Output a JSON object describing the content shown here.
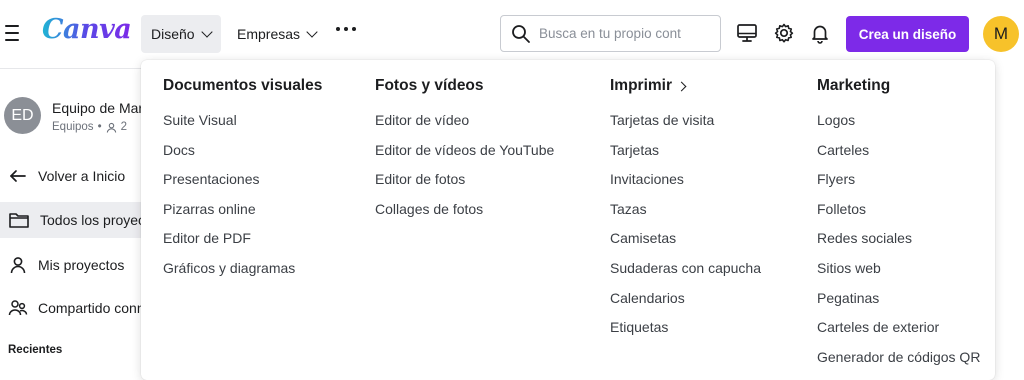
{
  "header": {
    "logo": "Canva",
    "nav": [
      {
        "label": "Diseño"
      },
      {
        "label": "Empresas"
      }
    ],
    "search_placeholder": "Busca en tu propio cont",
    "cta_label": "Crea un diseño",
    "avatar_initial": "M"
  },
  "sidebar": {
    "team_initials": "ED",
    "team_name": "Equipo de Mar",
    "team_type": "Equipos",
    "team_members": "2",
    "items": [
      {
        "label": "Volver a Inicio"
      },
      {
        "label": "Todos los proyec"
      },
      {
        "label": "Mis proyectos"
      },
      {
        "label": "Compartido conn"
      }
    ],
    "recent_label": "Recientes"
  },
  "megamenu": {
    "columns": [
      {
        "title": "Documentos visuales",
        "items": [
          "Suite Visual",
          "Docs",
          "Presentaciones",
          "Pizarras online",
          "Editor de PDF",
          "Gráficos y diagramas"
        ]
      },
      {
        "title": "Fotos y vídeos",
        "items": [
          "Editor de vídeo",
          "Editor de vídeos de YouTube",
          "Editor de fotos",
          "Collages de fotos"
        ]
      },
      {
        "title": "Imprimir",
        "items": [
          "Tarjetas de visita",
          "Tarjetas",
          "Invitaciones",
          "Tazas",
          "Camisetas",
          "Sudaderas con capucha",
          "Calendarios",
          "Etiquetas"
        ]
      },
      {
        "title": "Marketing",
        "items": [
          "Logos",
          "Carteles",
          "Flyers",
          "Folletos",
          "Redes sociales",
          "Sitios web",
          "Pegatinas",
          "Carteles de exterior",
          "Generador de códigos QR"
        ]
      }
    ]
  },
  "colors": {
    "brand": "#7d2ae8",
    "avatar": "#f7c22a"
  }
}
